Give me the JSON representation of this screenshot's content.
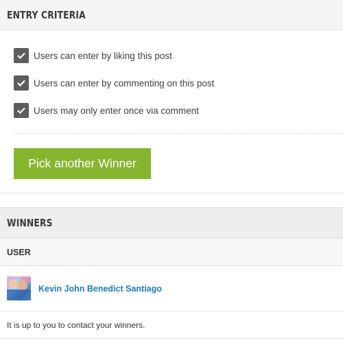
{
  "entry_criteria": {
    "title": "ENTRY CRITERIA",
    "items": [
      {
        "label": "Users can enter by liking this post",
        "checked": true
      },
      {
        "label": "Users can enter by commenting on this post",
        "checked": true
      },
      {
        "label": "Users may only enter once via comment",
        "checked": true
      }
    ],
    "pick_button_label": "Pick another Winner"
  },
  "winners": {
    "title": "WINNERS",
    "column_header": "USER",
    "rows": [
      {
        "name": "Kevin John Benedict Santiago",
        "avatar": "user-avatar-photo"
      }
    ],
    "note": "It is up to you to contact your winners."
  },
  "colors": {
    "button_green": "#86b530",
    "link_blue": "#1a7bc0",
    "checkbox_gray": "#5d5d5d"
  },
  "icons": {
    "checkmark": "check-icon"
  }
}
